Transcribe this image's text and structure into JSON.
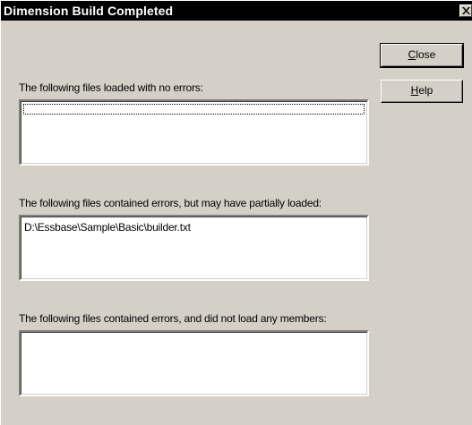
{
  "window": {
    "title": "Dimension Build Completed",
    "close_glyph": "close-icon"
  },
  "buttons": {
    "close": {
      "mnemonic": "C",
      "rest": "lose"
    },
    "help": {
      "mnemonic": "H",
      "rest": "elp"
    }
  },
  "sections": [
    {
      "label": "The following files loaded with no errors:",
      "files": []
    },
    {
      "label": "The following files contained errors, but may have partially loaded:",
      "files": [
        "D:\\Essbase\\Sample\\Basic\\builder.txt"
      ]
    },
    {
      "label": "The following files contained errors, and did not load any members:",
      "files": []
    }
  ]
}
